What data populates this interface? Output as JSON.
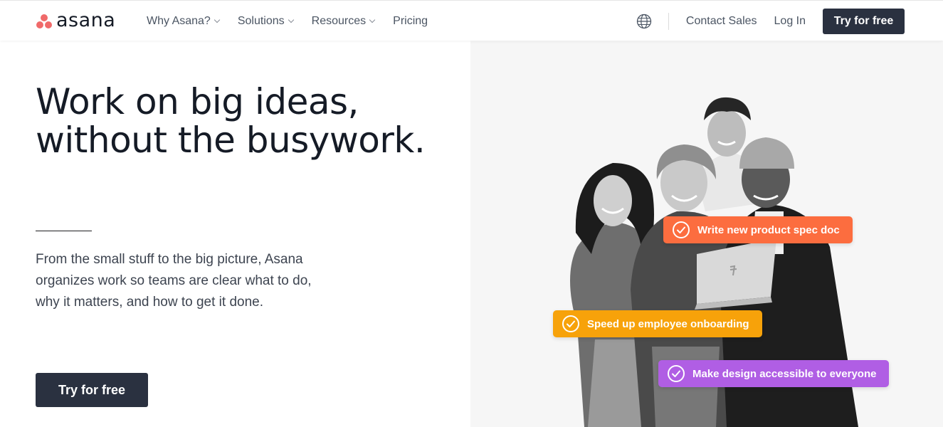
{
  "brand": {
    "name": "asana",
    "logo_color": "#f06a6a"
  },
  "nav": {
    "items": [
      {
        "label": "Why Asana?",
        "has_dropdown": true
      },
      {
        "label": "Solutions",
        "has_dropdown": true
      },
      {
        "label": "Resources",
        "has_dropdown": true
      },
      {
        "label": "Pricing",
        "has_dropdown": false
      }
    ],
    "language_icon": "globe-icon",
    "contact_sales": "Contact Sales",
    "log_in": "Log In",
    "cta": "Try for free"
  },
  "hero": {
    "headline_line1": "Work on big ideas,",
    "headline_line2": "without the busywork.",
    "subcopy": "From the small stuff to the big picture, Asana organizes work so teams are clear what to do, why it matters, and how to get it done.",
    "cta": "Try for free",
    "tasks": [
      {
        "label": "Write new product spec doc",
        "color": "#fc6d3f",
        "icon": "check-circle-icon"
      },
      {
        "label": "Speed up employee onboarding",
        "color": "#f7a20a",
        "icon": "check-circle-icon"
      },
      {
        "label": "Make design accessible to everyone",
        "color": "#b05ee4",
        "icon": "check-circle-icon"
      }
    ]
  },
  "colors": {
    "primary_button": "#2a3140",
    "panel_background": "#f6f6f6"
  }
}
